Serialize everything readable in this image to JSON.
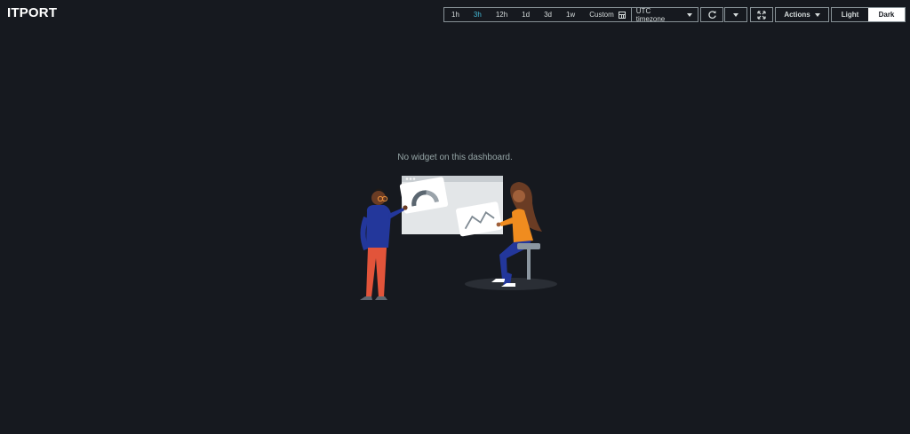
{
  "app": {
    "title": "ITPORT"
  },
  "time_range": {
    "options": [
      "1h",
      "3h",
      "12h",
      "1d",
      "3d",
      "1w"
    ],
    "selected": "3h",
    "custom_label": "Custom",
    "timezone": "UTC timezone"
  },
  "toolbar": {
    "actions_label": "Actions"
  },
  "theme": {
    "light_label": "Light",
    "dark_label": "Dark",
    "selected": "Dark"
  },
  "main": {
    "empty_message": "No widget on this dashboard."
  },
  "colors": {
    "background": "#16191f",
    "accent": "#44b9d6",
    "border": "#879196",
    "text": "#d5dbdb"
  },
  "icons": [
    "calendar-icon",
    "refresh-icon",
    "dropdown-caret-icon",
    "fullscreen-icon",
    "empty-dashboard-illustration"
  ]
}
